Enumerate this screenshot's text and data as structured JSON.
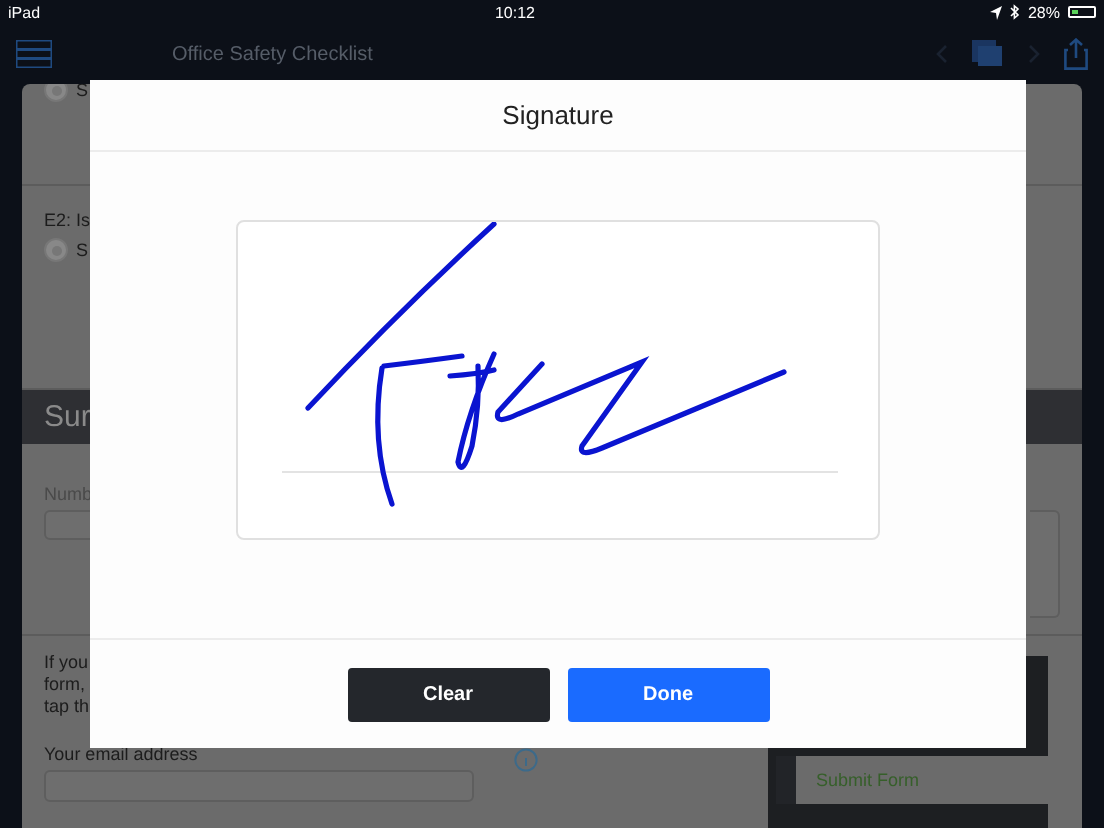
{
  "status_bar": {
    "carrier": "iPad",
    "time": "10:12",
    "battery": "28%"
  },
  "nav_bar": {
    "title": "Office Safety Checklist"
  },
  "form": {
    "question_1": {
      "options": [
        {
          "label": "S",
          "selected": false
        }
      ]
    },
    "question_2": {
      "label": "E2: Is",
      "options": [
        {
          "label": "S",
          "selected": false
        }
      ]
    },
    "section_header": "Sur",
    "number_field": {
      "label": "Numb"
    },
    "email_note": [
      "If you",
      "form,",
      "tap th"
    ],
    "email_field": {
      "label": "Your email address"
    },
    "side_menu": {
      "items": [
        {
          "label": "Submit Form"
        }
      ]
    }
  },
  "dialog": {
    "title": "Signature",
    "buttons": [
      {
        "label": "Clear",
        "kind": "secondary"
      },
      {
        "label": "Done",
        "kind": "primary"
      }
    ]
  }
}
